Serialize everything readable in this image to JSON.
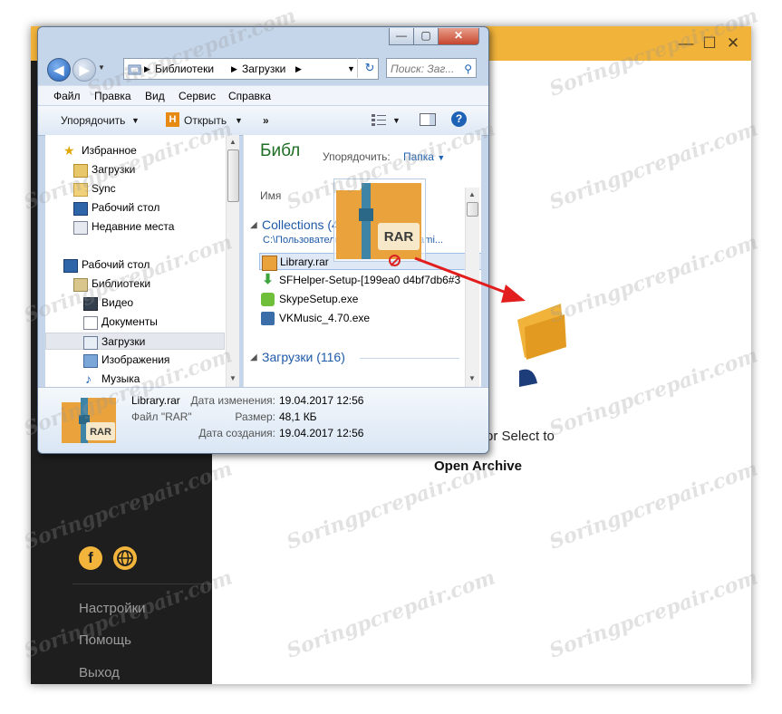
{
  "background_app": {
    "window_buttons": [
      "—",
      "☐",
      "✕"
    ],
    "sidebar_menu": [
      "Настройки",
      "Помощь",
      "Выход"
    ],
    "drop_hint": "or Select to",
    "open_archive": "Open Archive",
    "accent_color": "#f1b33a",
    "sidebar_color": "#1e1e1e",
    "social_icons": [
      "facebook-icon",
      "globe-icon"
    ]
  },
  "explorer": {
    "window_buttons": [
      "—",
      "▢",
      "✕"
    ],
    "address": {
      "segments": [
        "Библиотеки",
        "Загрузки"
      ]
    },
    "search": {
      "placeholder": "Поиск: Заг..."
    },
    "menu": [
      "Файл",
      "Правка",
      "Вид",
      "Сервис",
      "Справка"
    ],
    "toolbar": {
      "organize": "Упорядочить",
      "open": "Открыть",
      "more": "»"
    },
    "nav_pane": {
      "items": [
        {
          "label": "Избранное",
          "icon": "star-icon"
        },
        {
          "label": "Загрузки",
          "icon": "downloads-folder-icon"
        },
        {
          "label": "Sync",
          "icon": "folder-icon"
        },
        {
          "label": "Рабочий стол",
          "icon": "desktop-icon"
        },
        {
          "label": "Недавние места",
          "icon": "recent-places-icon"
        },
        {
          "label": "Рабочий стол",
          "icon": "desktop-icon"
        },
        {
          "label": "Библиотеки",
          "icon": "libraries-icon"
        },
        {
          "label": "Видео",
          "icon": "video-icon"
        },
        {
          "label": "Документы",
          "icon": "documents-icon"
        },
        {
          "label": "Загрузки",
          "icon": "downloads-folder-icon",
          "selected": true
        },
        {
          "label": "Изображения",
          "icon": "pictures-icon"
        },
        {
          "label": "Музыка",
          "icon": "music-icon"
        }
      ]
    },
    "content": {
      "library_title": "Библ",
      "sort_label": "Упорядочить:",
      "sort_value": "Папка",
      "column_name": "Имя",
      "groups": [
        {
          "title": "Collections (4)",
          "path": "C:\\Пользователи\\ГКИ\\AppData\\Roami..."
        },
        {
          "title": "Загрузки (116)"
        }
      ],
      "files": [
        {
          "name": "Library.rar",
          "icon": "rar-icon",
          "selected": true
        },
        {
          "name": "SFHelper-Setup-[199ea0 d4bf7db6#3",
          "icon": "download-arrow-icon"
        },
        {
          "name": "SkypeSetup.exe",
          "icon": "skype-icon"
        },
        {
          "name": "VKMusic_4.70.exe",
          "icon": "vkmusic-icon"
        }
      ]
    },
    "details": {
      "name": "Library.rar",
      "type": "Файл \"RAR\"",
      "fields": [
        {
          "label": "Дата изменения:",
          "value": "19.04.2017 12:56"
        },
        {
          "label": "Размер:",
          "value": "48,1 КБ"
        },
        {
          "label": "Дата создания:",
          "value": "19.04.2017 12:56"
        }
      ]
    },
    "rar_label": "RAR"
  },
  "watermark": "Soringpcrepair.com"
}
